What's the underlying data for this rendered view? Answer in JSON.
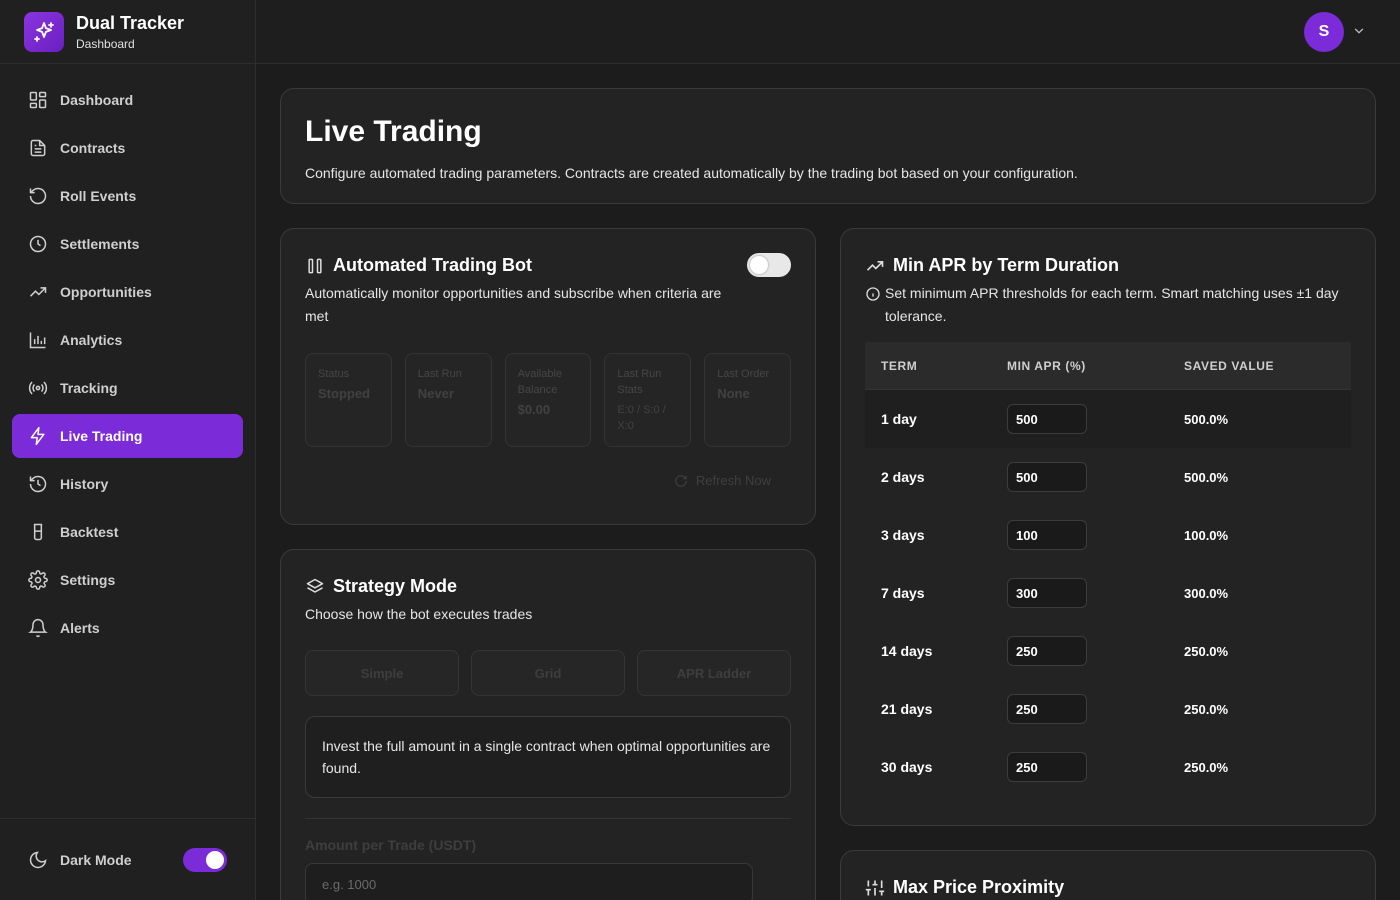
{
  "brand": {
    "title": "Dual Tracker",
    "subtitle": "Dashboard"
  },
  "user": {
    "initial": "S"
  },
  "sidebar": {
    "items": [
      {
        "label": "Dashboard",
        "icon": "grid-icon",
        "active": false
      },
      {
        "label": "Contracts",
        "icon": "document-icon",
        "active": false
      },
      {
        "label": "Roll Events",
        "icon": "rotate-icon",
        "active": false
      },
      {
        "label": "Settlements",
        "icon": "clock-icon",
        "active": false
      },
      {
        "label": "Opportunities",
        "icon": "trending-up-icon",
        "active": false
      },
      {
        "label": "Analytics",
        "icon": "bar-chart-icon",
        "active": false
      },
      {
        "label": "Tracking",
        "icon": "radio-icon",
        "active": false
      },
      {
        "label": "Live Trading",
        "icon": "zap-icon",
        "active": true
      },
      {
        "label": "History",
        "icon": "history-icon",
        "active": false
      },
      {
        "label": "Backtest",
        "icon": "flask-icon",
        "active": false
      },
      {
        "label": "Settings",
        "icon": "gear-icon",
        "active": false
      },
      {
        "label": "Alerts",
        "icon": "bell-icon",
        "active": false
      }
    ],
    "dark_mode_label": "Dark Mode",
    "dark_mode_on": true
  },
  "header": {
    "title": "Live Trading",
    "description": "Configure automated trading parameters. Contracts are created automatically by the trading bot based on your configuration."
  },
  "bot": {
    "title": "Automated Trading Bot",
    "description": "Automatically monitor opportunities and subscribe when criteria are met",
    "enabled": false,
    "stats": [
      {
        "label": "Status",
        "value": "Stopped"
      },
      {
        "label": "Last Run",
        "value": "Never"
      },
      {
        "label": "Available Balance",
        "value": "$0.00"
      },
      {
        "label": "Last Run Stats",
        "value": "E:0 / S:0 / X:0"
      },
      {
        "label": "Last Order",
        "value": "None"
      }
    ],
    "refresh_label": "Refresh Now"
  },
  "strategy": {
    "title": "Strategy Mode",
    "description": "Choose how the bot executes trades",
    "modes": [
      "Simple",
      "Grid",
      "APR Ladder"
    ],
    "info": "Invest the full amount in a single contract when optimal opportunities are found.",
    "amount_label": "Amount per Trade (USDT)",
    "amount_placeholder": "e.g. 1000"
  },
  "apr": {
    "title": "Min APR by Term Duration",
    "description": "Set minimum APR thresholds for each term. Smart matching uses ±1 day tolerance.",
    "headers": [
      "TERM",
      "MIN APR (%)",
      "SAVED VALUE"
    ],
    "rows": [
      {
        "term": "1 day",
        "value": "500",
        "saved": "500.0%"
      },
      {
        "term": "2 days",
        "value": "500",
        "saved": "500.0%"
      },
      {
        "term": "3 days",
        "value": "100",
        "saved": "100.0%"
      },
      {
        "term": "7 days",
        "value": "300",
        "saved": "300.0%"
      },
      {
        "term": "14 days",
        "value": "250",
        "saved": "250.0%"
      },
      {
        "term": "21 days",
        "value": "250",
        "saved": "250.0%"
      },
      {
        "term": "30 days",
        "value": "250",
        "saved": "250.0%"
      }
    ]
  },
  "proximity": {
    "title": "Max Price Proximity"
  },
  "colors": {
    "accent": "#7c2bd8",
    "background": "#1c1c1c",
    "card": "#232323"
  }
}
